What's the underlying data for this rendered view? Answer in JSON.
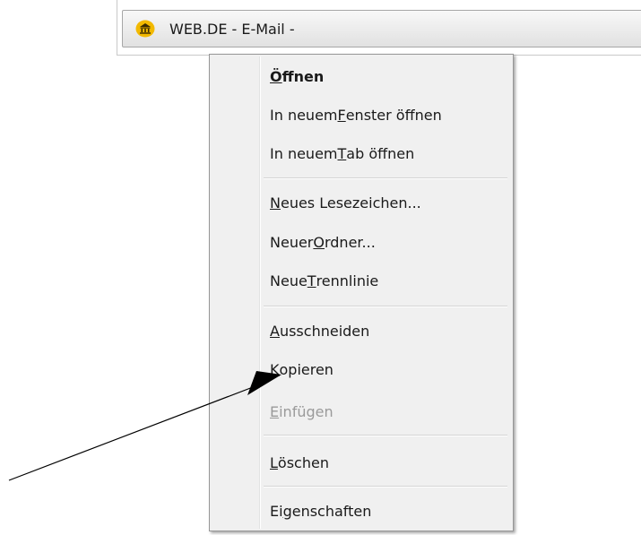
{
  "bookmark": {
    "label": "WEB.DE - E-Mail -",
    "icon": "webde-favicon"
  },
  "menu": {
    "items": [
      {
        "pre": "",
        "acc": "Ö",
        "post": "ffnen"
      },
      {
        "pre": "In neuem ",
        "acc": "F",
        "post": "enster öffnen"
      },
      {
        "pre": "In neuem ",
        "acc": "T",
        "post": "ab öffnen"
      },
      {
        "pre": "",
        "acc": "N",
        "post": "eues Lesezeichen..."
      },
      {
        "pre": "Neuer ",
        "acc": "O",
        "post": "rdner..."
      },
      {
        "pre": "Neue ",
        "acc": "T",
        "post": "rennlinie"
      },
      {
        "pre": "",
        "acc": "A",
        "post": "usschneiden"
      },
      {
        "pre": "",
        "acc": "K",
        "post": "opieren"
      },
      {
        "pre": "",
        "acc": "E",
        "post": "infügen"
      },
      {
        "pre": "",
        "acc": "L",
        "post": "öschen"
      },
      {
        "pre": "Ei",
        "acc": "g",
        "post": "enschaften"
      }
    ]
  },
  "colors": {
    "menu_background": "#f0f0f0",
    "disabled_text": "#9a9a9a",
    "favicon": "#f2b900",
    "arrow": "#000000"
  }
}
